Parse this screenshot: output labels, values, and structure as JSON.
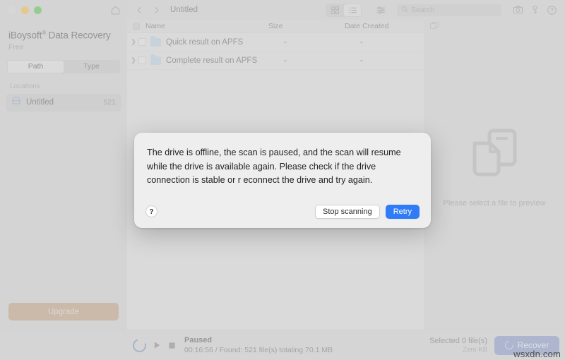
{
  "window": {
    "traffic_lights": [
      "close",
      "minimize",
      "maximize"
    ],
    "home_icon": "home-icon"
  },
  "sidebar": {
    "brand_name": "iBoysoft",
    "brand_registered": "®",
    "brand_product": " Data Recovery",
    "edition": "Free",
    "segmented": {
      "options": [
        "Path",
        "Type"
      ],
      "selected": "Path"
    },
    "locations_label": "Locations",
    "locations": [
      {
        "icon": "drive-icon",
        "name": "Untitled",
        "count": "521"
      }
    ],
    "upgrade_label": "Upgrade",
    "upgrade_color": "#c2a084"
  },
  "toolbar": {
    "back_icon": "chevron-left-icon",
    "forward_icon": "chevron-right-icon",
    "breadcrumb": "Untitled",
    "view_modes": [
      {
        "icon": "grid-view-icon",
        "selected": false
      },
      {
        "icon": "list-view-icon",
        "selected": true
      }
    ],
    "filter_icon": "sliders-icon",
    "search": {
      "icon": "search-icon",
      "placeholder": "Search",
      "value": ""
    },
    "right_icons": [
      "camera-icon",
      "key-icon",
      "help-circle-icon"
    ]
  },
  "filelist": {
    "columns": [
      "Name",
      "Size",
      "Date Created"
    ],
    "rows": [
      {
        "name": "Quick result on APFS",
        "size": "-",
        "date": "-",
        "icon": "folder-icon",
        "expanded": false,
        "checked": false
      },
      {
        "name": "Complete result on APFS",
        "size": "-",
        "date": "-",
        "icon": "folder-icon",
        "expanded": false,
        "checked": false
      }
    ]
  },
  "preview": {
    "toolbar_icon": "folder-stack-icon",
    "empty_icon": "documents-icon",
    "empty_text": "Please select a file to preview"
  },
  "statusbar": {
    "spinner_icon": "loading-spinner-icon",
    "play_icon": "play-icon",
    "stop_icon": "stop-icon",
    "state": "Paused",
    "detail": "00:16:56 / Found: 521 file(s) totaling 70.1 MB",
    "selected_line1": "Selected 0 file(s)",
    "selected_line2": "Zero KB",
    "recover_label": "Recover",
    "recover_icon": "recover-refresh-icon",
    "recover_color": "#8a9bc6"
  },
  "modal": {
    "message": "The drive is offline, the scan is paused, and the scan will resume while the drive is available again. Please check if the drive connection is stable or r econnect the drive and try again.",
    "help_label": "?",
    "secondary_button": "Stop scanning",
    "primary_button": "Retry",
    "primary_color": "#2f7cf6"
  },
  "watermark": "wsxdn.com"
}
